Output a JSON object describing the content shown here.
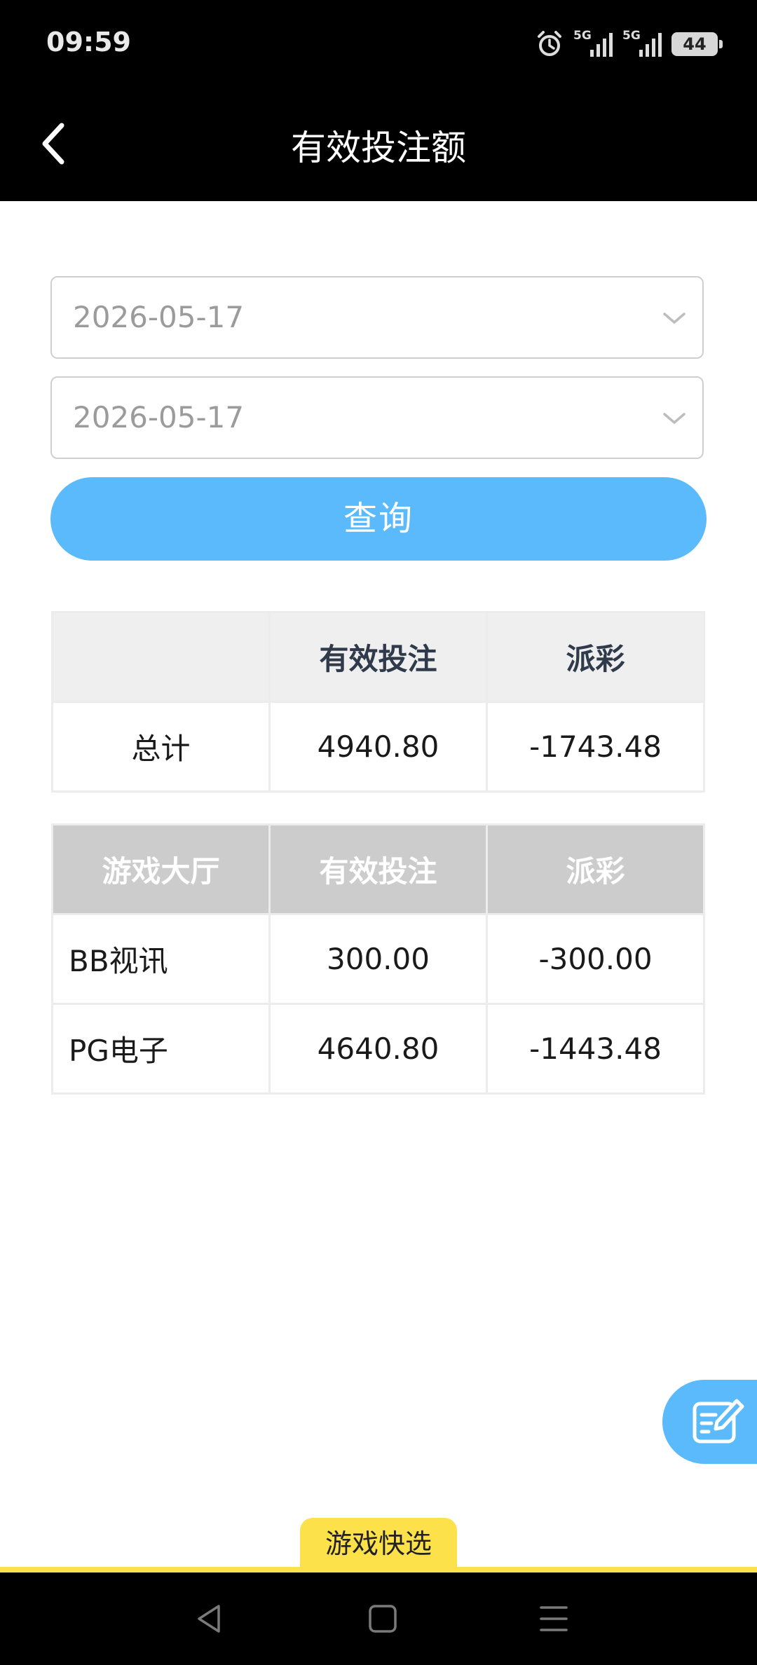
{
  "status_bar": {
    "time": "09:59",
    "sim1_label": "5G",
    "sim2_label": "5G",
    "battery": "44",
    "icons": [
      "alarm-icon",
      "signal-5g-icon",
      "signal-5g-icon",
      "battery-icon"
    ]
  },
  "header": {
    "title": "有效投注额",
    "back_icon": "back-arrow-icon"
  },
  "filters": {
    "start_date": "2026-05-17",
    "end_date": "2026-05-17",
    "query_label": "查询"
  },
  "summary_table": {
    "headers": [
      "",
      "有效投注",
      "派彩"
    ],
    "rows": [
      [
        "总计",
        "4940.80",
        "-1743.48"
      ]
    ]
  },
  "games_table": {
    "headers": [
      "游戏大厅",
      "有效投注",
      "派彩"
    ],
    "rows": [
      [
        "BB视讯",
        "300.00",
        "-300.00"
      ],
      [
        "PG电子",
        "4640.80",
        "-1443.48"
      ]
    ]
  },
  "quick_select_label": "游戏快选",
  "colors": {
    "accent": "#5bbafb",
    "tab_yellow": "#fde14a",
    "header_bg": "#000000"
  }
}
